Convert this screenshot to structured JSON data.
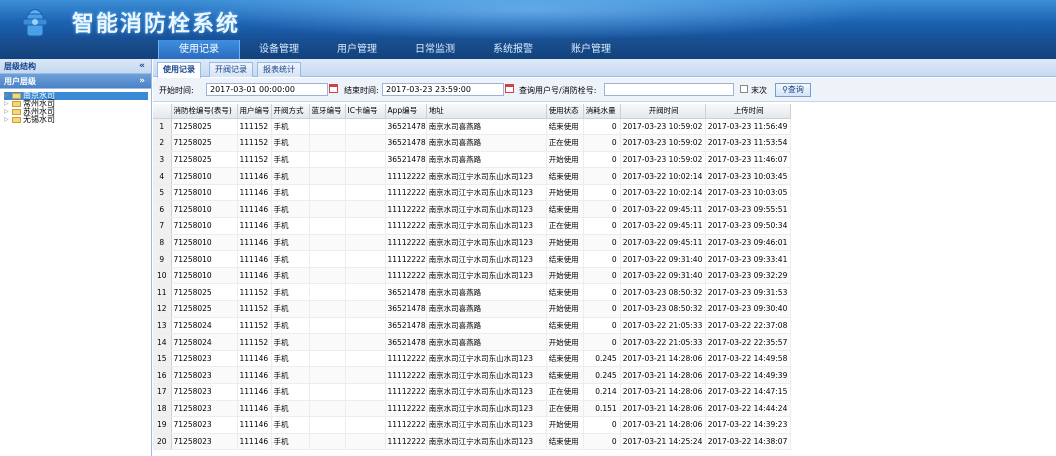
{
  "header": {
    "title": "智能消防栓系统",
    "menu": [
      "使用记录",
      "设备管理",
      "用户管理",
      "日常监测",
      "系统报警",
      "账户管理"
    ]
  },
  "sidebar": {
    "panel1_title": "层级结构",
    "panel1_tool": "«",
    "panel2_title": "用户层级",
    "panel2_tool": "»",
    "tree": [
      "南京水司",
      "常州水司",
      "苏州水司",
      "无锡水司"
    ]
  },
  "subtabs": [
    "使用记录",
    "开阀记录",
    "报表统计"
  ],
  "filters": {
    "start_label": "开始时间:",
    "start_value": "2017-03-01 00:00:00",
    "end_label": "结束时间:",
    "end_value": "2017-03-23 23:59:00",
    "query_label": "查询用户号/消防栓号:",
    "query_value": "",
    "checkbox_label": "末次",
    "button_label": "查询"
  },
  "table": {
    "columns": [
      "",
      "消防栓编号(表号)",
      "用户编号",
      "开阀方式",
      "蓝牙编号",
      "IC卡编号",
      "App编号",
      "地址",
      "使用状态",
      "消耗水量",
      "开阀时间",
      "上传时间"
    ],
    "rows": [
      [
        "1",
        "71258025",
        "111152",
        "手机",
        "",
        "",
        "36521478",
        "南京水司喜燕路",
        "结束使用",
        "0",
        "2017-03-23 10:59:02",
        "2017-03-23 11:56:49"
      ],
      [
        "2",
        "71258025",
        "111152",
        "手机",
        "",
        "",
        "36521478",
        "南京水司喜燕路",
        "正在使用",
        "0",
        "2017-03-23 10:59:02",
        "2017-03-23 11:53:54"
      ],
      [
        "3",
        "71258025",
        "111152",
        "手机",
        "",
        "",
        "36521478",
        "南京水司喜燕路",
        "开始使用",
        "0",
        "2017-03-23 10:59:02",
        "2017-03-23 11:46:07"
      ],
      [
        "4",
        "71258010",
        "111146",
        "手机",
        "",
        "",
        "11112222",
        "南京水司江宁水司东山水司123",
        "结束使用",
        "0",
        "2017-03-22 10:02:14",
        "2017-03-23 10:03:45"
      ],
      [
        "5",
        "71258010",
        "111146",
        "手机",
        "",
        "",
        "11112222",
        "南京水司江宁水司东山水司123",
        "开始使用",
        "0",
        "2017-03-22 10:02:14",
        "2017-03-23 10:03:05"
      ],
      [
        "6",
        "71258010",
        "111146",
        "手机",
        "",
        "",
        "11112222",
        "南京水司江宁水司东山水司123",
        "结束使用",
        "0",
        "2017-03-22 09:45:11",
        "2017-03-23 09:55:51"
      ],
      [
        "7",
        "71258010",
        "111146",
        "手机",
        "",
        "",
        "11112222",
        "南京水司江宁水司东山水司123",
        "正在使用",
        "0",
        "2017-03-22 09:45:11",
        "2017-03-23 09:50:34"
      ],
      [
        "8",
        "71258010",
        "111146",
        "手机",
        "",
        "",
        "11112222",
        "南京水司江宁水司东山水司123",
        "开始使用",
        "0",
        "2017-03-22 09:45:11",
        "2017-03-23 09:46:01"
      ],
      [
        "9",
        "71258010",
        "111146",
        "手机",
        "",
        "",
        "11112222",
        "南京水司江宁水司东山水司123",
        "结束使用",
        "0",
        "2017-03-22 09:31:40",
        "2017-03-23 09:33:41"
      ],
      [
        "10",
        "71258010",
        "111146",
        "手机",
        "",
        "",
        "11112222",
        "南京水司江宁水司东山水司123",
        "开始使用",
        "0",
        "2017-03-22 09:31:40",
        "2017-03-23 09:32:29"
      ],
      [
        "11",
        "71258025",
        "111152",
        "手机",
        "",
        "",
        "36521478",
        "南京水司喜燕路",
        "结束使用",
        "0",
        "2017-03-23 08:50:32",
        "2017-03-23 09:31:53"
      ],
      [
        "12",
        "71258025",
        "111152",
        "手机",
        "",
        "",
        "36521478",
        "南京水司喜燕路",
        "开始使用",
        "0",
        "2017-03-23 08:50:32",
        "2017-03-23 09:30:40"
      ],
      [
        "13",
        "71258024",
        "111152",
        "手机",
        "",
        "",
        "36521478",
        "南京水司喜燕路",
        "结束使用",
        "0",
        "2017-03-22 21:05:33",
        "2017-03-22 22:37:08"
      ],
      [
        "14",
        "71258024",
        "111152",
        "手机",
        "",
        "",
        "36521478",
        "南京水司喜燕路",
        "开始使用",
        "0",
        "2017-03-22 21:05:33",
        "2017-03-22 22:35:57"
      ],
      [
        "15",
        "71258023",
        "111146",
        "手机",
        "",
        "",
        "11112222",
        "南京水司江宁水司东山水司123",
        "结束使用",
        "0.245",
        "2017-03-21 14:28:06",
        "2017-03-22 14:49:58"
      ],
      [
        "16",
        "71258023",
        "111146",
        "手机",
        "",
        "",
        "11112222",
        "南京水司江宁水司东山水司123",
        "结束使用",
        "0.245",
        "2017-03-21 14:28:06",
        "2017-03-22 14:49:39"
      ],
      [
        "17",
        "71258023",
        "111146",
        "手机",
        "",
        "",
        "11112222",
        "南京水司江宁水司东山水司123",
        "正在使用",
        "0.214",
        "2017-03-21 14:28:06",
        "2017-03-22 14:47:15"
      ],
      [
        "18",
        "71258023",
        "111146",
        "手机",
        "",
        "",
        "11112222",
        "南京水司江宁水司东山水司123",
        "正在使用",
        "0.151",
        "2017-03-21 14:28:06",
        "2017-03-22 14:44:24"
      ],
      [
        "19",
        "71258023",
        "111146",
        "手机",
        "",
        "",
        "11112222",
        "南京水司江宁水司东山水司123",
        "开始使用",
        "0",
        "2017-03-21 14:28:06",
        "2017-03-22 14:39:23"
      ],
      [
        "20",
        "71258023",
        "111146",
        "手机",
        "",
        "",
        "11112222",
        "南京水司江宁水司东山水司123",
        "结束使用",
        "0",
        "2017-03-21 14:25:24",
        "2017-03-22 14:38:07"
      ]
    ]
  }
}
